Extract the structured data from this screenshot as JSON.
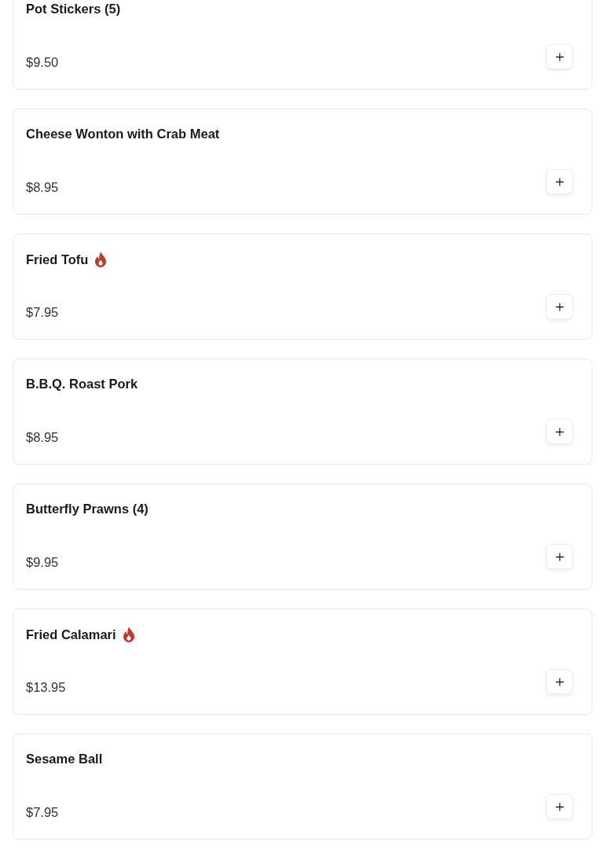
{
  "menu_items": [
    {
      "name": "Pot Stickers (5)",
      "price": "$9.50",
      "spicy": false
    },
    {
      "name": "Cheese Wonton with Crab Meat",
      "price": "$8.95",
      "spicy": false
    },
    {
      "name": "Fried Tofu",
      "price": "$7.95",
      "spicy": true
    },
    {
      "name": "B.B.Q. Roast Pork",
      "price": "$8.95",
      "spicy": false
    },
    {
      "name": "Butterfly Prawns (4)",
      "price": "$9.95",
      "spicy": false
    },
    {
      "name": "Fried Calamari",
      "price": "$13.95",
      "spicy": true
    },
    {
      "name": "Sesame Ball",
      "price": "$7.95",
      "spicy": false
    }
  ]
}
